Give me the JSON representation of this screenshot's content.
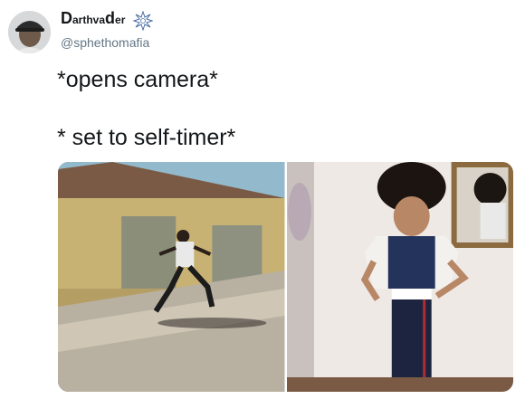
{
  "author": {
    "display_name": {
      "part1_big": "D",
      "part1_small": "arth ",
      "part2_small": "va",
      "part2_big": "d",
      "part2_small_end": "er"
    },
    "handle": "@sphethomafia",
    "badge_icon": "sparkle-burst-icon",
    "avatar_icon": "profile-photo"
  },
  "tweet": {
    "line1": "*opens camera*",
    "line2": "* set to self-timer*"
  },
  "media": {
    "photos": [
      {
        "name": "running-man-photo"
      },
      {
        "name": "girl-posing-photo"
      }
    ]
  }
}
